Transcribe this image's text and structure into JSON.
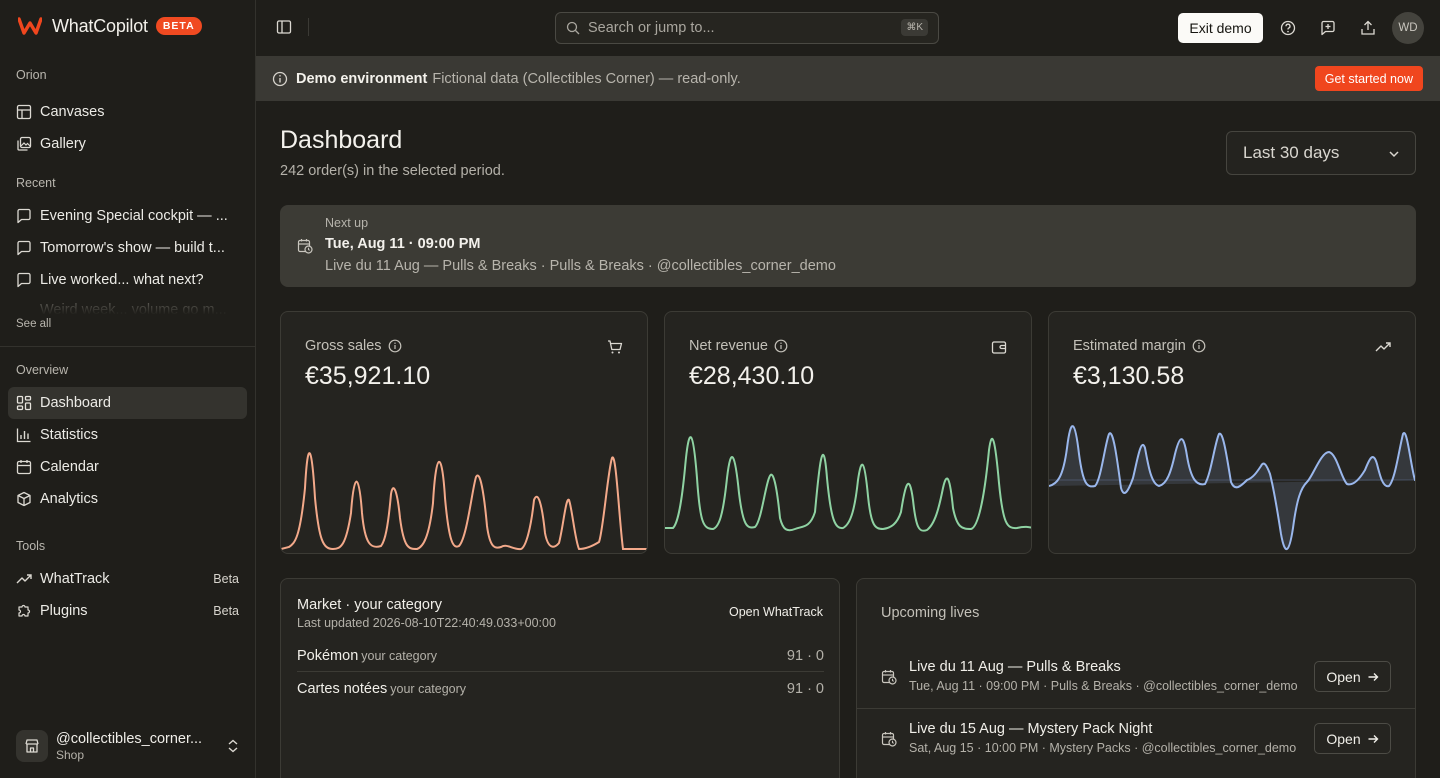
{
  "brand": {
    "name": "WhatCopilot",
    "badge": "BETA",
    "accent": "#f0461e"
  },
  "sidebar": {
    "workspace_section": "Orion",
    "workspace_items": [
      {
        "label": "Canvases",
        "icon": "table-icon"
      },
      {
        "label": "Gallery",
        "icon": "gallery-icon"
      }
    ],
    "recent_section": "Recent",
    "recent_items": [
      {
        "label": "Evening Special cockpit — ...",
        "icon": "chat-icon"
      },
      {
        "label": "Tomorrow's show — build t...",
        "icon": "chat-icon"
      },
      {
        "label": "Live worked... what next?",
        "icon": "chat-icon"
      },
      {
        "label": "Weird week... volume go m...",
        "icon": "chat-icon"
      }
    ],
    "see_all": "See all",
    "overview_section": "Overview",
    "overview_items": [
      {
        "label": "Dashboard",
        "icon": "dashboard-icon",
        "active": true
      },
      {
        "label": "Statistics",
        "icon": "bar-chart-icon"
      },
      {
        "label": "Calendar",
        "icon": "calendar-icon"
      },
      {
        "label": "Analytics",
        "icon": "cube-icon"
      }
    ],
    "tools_section": "Tools",
    "tools_items": [
      {
        "label": "WhatTrack",
        "icon": "trend-icon",
        "badge": "Beta"
      },
      {
        "label": "Plugins",
        "icon": "puzzle-icon",
        "badge": "Beta"
      }
    ],
    "account": {
      "handle": "@collectibles_corner...",
      "role": "Shop"
    }
  },
  "topbar": {
    "search_placeholder": "Search or jump to...",
    "search_shortcut": "⌘K",
    "exit_demo": "Exit demo",
    "avatar_initials": "WD"
  },
  "banner": {
    "title": "Demo environment",
    "text": "Fictional data (Collectibles Corner) — read-only.",
    "cta": "Get started now"
  },
  "dashboard": {
    "title": "Dashboard",
    "subtitle": "242 order(s) in the selected period.",
    "period": "Last 30 days"
  },
  "next_up": {
    "label": "Next up",
    "when": "Tue, Aug 11 · 09:00 PM",
    "desc": "Live du 11 Aug — Pulls & Breaks · Pulls & Breaks · @collectibles_corner_demo"
  },
  "kpis": [
    {
      "label": "Gross sales",
      "value": "€35,921.10",
      "icon": "cart-icon",
      "color": "#f3a98a"
    },
    {
      "label": "Net revenue",
      "value": "€28,430.10",
      "icon": "wallet-icon",
      "color": "#8fd3a3"
    },
    {
      "label": "Estimated margin",
      "value": "€3,130.58",
      "icon": "trend-up-icon",
      "color": "#9ab7ec"
    }
  ],
  "market": {
    "title": "Market · your category",
    "updated": "Last updated 2026-08-10T22:40:49.033+00:00",
    "open_link": "Open WhatTrack",
    "rows": [
      {
        "name": "Pokémon",
        "tag": "your category",
        "value": "91 · 0"
      },
      {
        "name": "Cartes notées",
        "tag": "your category",
        "value": "91 · 0"
      }
    ]
  },
  "upcoming": {
    "title": "Upcoming lives",
    "open_label": "Open",
    "items": [
      {
        "title": "Live du 11 Aug — Pulls & Breaks",
        "sub": "Tue, Aug 11 · 09:00 PM · Pulls & Breaks · @collectibles_corner_demo"
      },
      {
        "title": "Live du 15 Aug — Mystery Pack Night",
        "sub": "Sat, Aug 15 · 10:00 PM · Mystery Packs · @collectibles_corner_demo"
      }
    ]
  }
}
